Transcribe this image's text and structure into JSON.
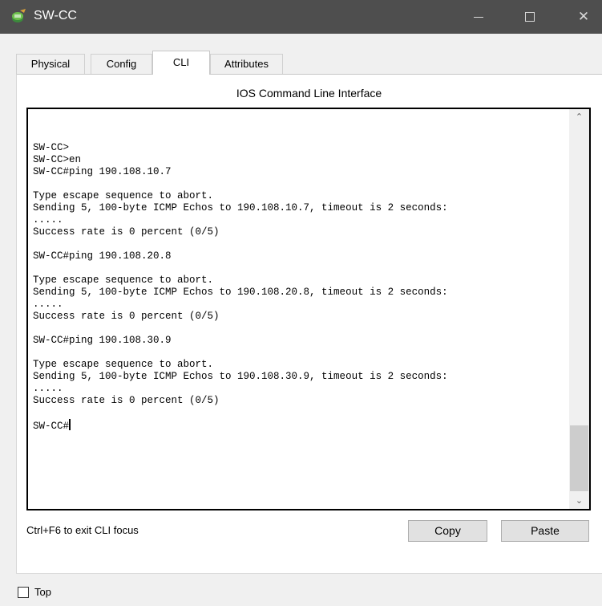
{
  "window": {
    "title": "SW-CC",
    "icon": "switch-icon",
    "controls": {
      "minimize": "minimize-icon",
      "maximize": "maximize-icon",
      "close": "✕"
    }
  },
  "tabs": [
    {
      "label": "Physical",
      "active": false
    },
    {
      "label": "Config",
      "active": false
    },
    {
      "label": "CLI",
      "active": true
    },
    {
      "label": "Attributes",
      "active": false
    }
  ],
  "panel": {
    "title": "IOS Command Line Interface"
  },
  "terminal": {
    "lines": [
      "SW-CC>",
      "SW-CC>en",
      "SW-CC#ping 190.108.10.7",
      "",
      "Type escape sequence to abort.",
      "Sending 5, 100-byte ICMP Echos to 190.108.10.7, timeout is 2 seconds:",
      ".....",
      "Success rate is 0 percent (0/5)",
      "",
      "SW-CC#ping 190.108.20.8",
      "",
      "Type escape sequence to abort.",
      "Sending 5, 100-byte ICMP Echos to 190.108.20.8, timeout is 2 seconds:",
      ".....",
      "Success rate is 0 percent (0/5)",
      "",
      "SW-CC#ping 190.108.30.9",
      "",
      "Type escape sequence to abort.",
      "Sending 5, 100-byte ICMP Echos to 190.108.30.9, timeout is 2 seconds:",
      ".....",
      "Success rate is 0 percent (0/5)",
      "",
      "SW-CC#"
    ],
    "scroll_up": "⌃",
    "scroll_down": "⌄"
  },
  "footer": {
    "hint": "Ctrl+F6 to exit CLI focus",
    "copy_label": "Copy",
    "paste_label": "Paste",
    "top_checkbox_label": "Top",
    "top_checked": false
  },
  "colors": {
    "titlebar": "#4e4e4e",
    "panel": "#ffffff",
    "background": "#f0f0f0"
  }
}
